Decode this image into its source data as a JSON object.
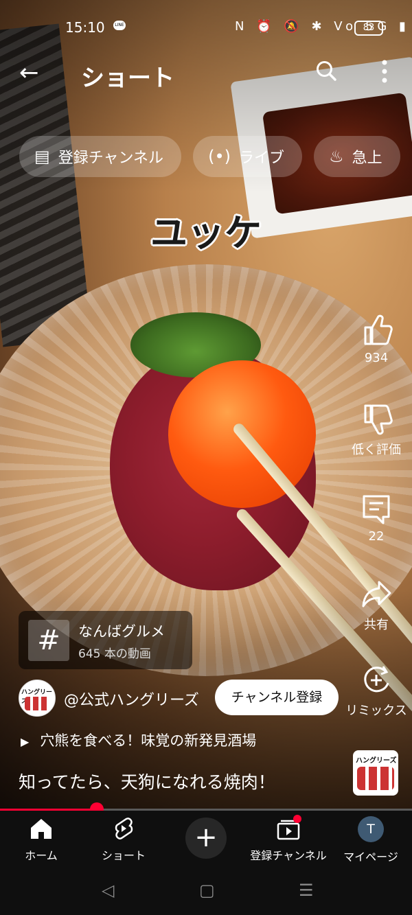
{
  "status_bar": {
    "time": "15:10",
    "line": "LINE",
    "indicators": "N ⏰ 🔕 ✱ Vo 5G ▮",
    "battery": "83"
  },
  "header": {
    "title": "ショート",
    "back_icon": "arrow-left",
    "search_icon": "search",
    "more_icon": "more-vertical"
  },
  "chips": [
    {
      "label": "登録チャンネル",
      "icon": "subscriptions"
    },
    {
      "label": "ライブ",
      "icon": "live"
    },
    {
      "label": "急上",
      "icon": "trending"
    }
  ],
  "video": {
    "caption": "ユッケ"
  },
  "actions": {
    "like_count": "934",
    "dislike_label": "低く評価",
    "comment_count": "22",
    "share_label": "共有",
    "remix_label": "リミックス"
  },
  "hashtag": {
    "name": "なんばグルメ",
    "count": "645 本の動画"
  },
  "channel": {
    "handle": "@公式ハングリーズ",
    "subscribe_label": "チャンネル登録",
    "avatar_text": "ハングリーズ"
  },
  "related_video": "穴熊を食べる！味覚の新発見酒場",
  "title": "知ってたら、天狗になれる焼肉！",
  "sound_thumb_text": "ハングリーズ",
  "progress": {
    "played_percent": 23.5,
    "color": "#ff0033"
  },
  "nav": {
    "home": "ホーム",
    "shorts": "ショート",
    "subscriptions": "登録チャンネル",
    "you": "マイページ",
    "avatar_letter": "T"
  }
}
